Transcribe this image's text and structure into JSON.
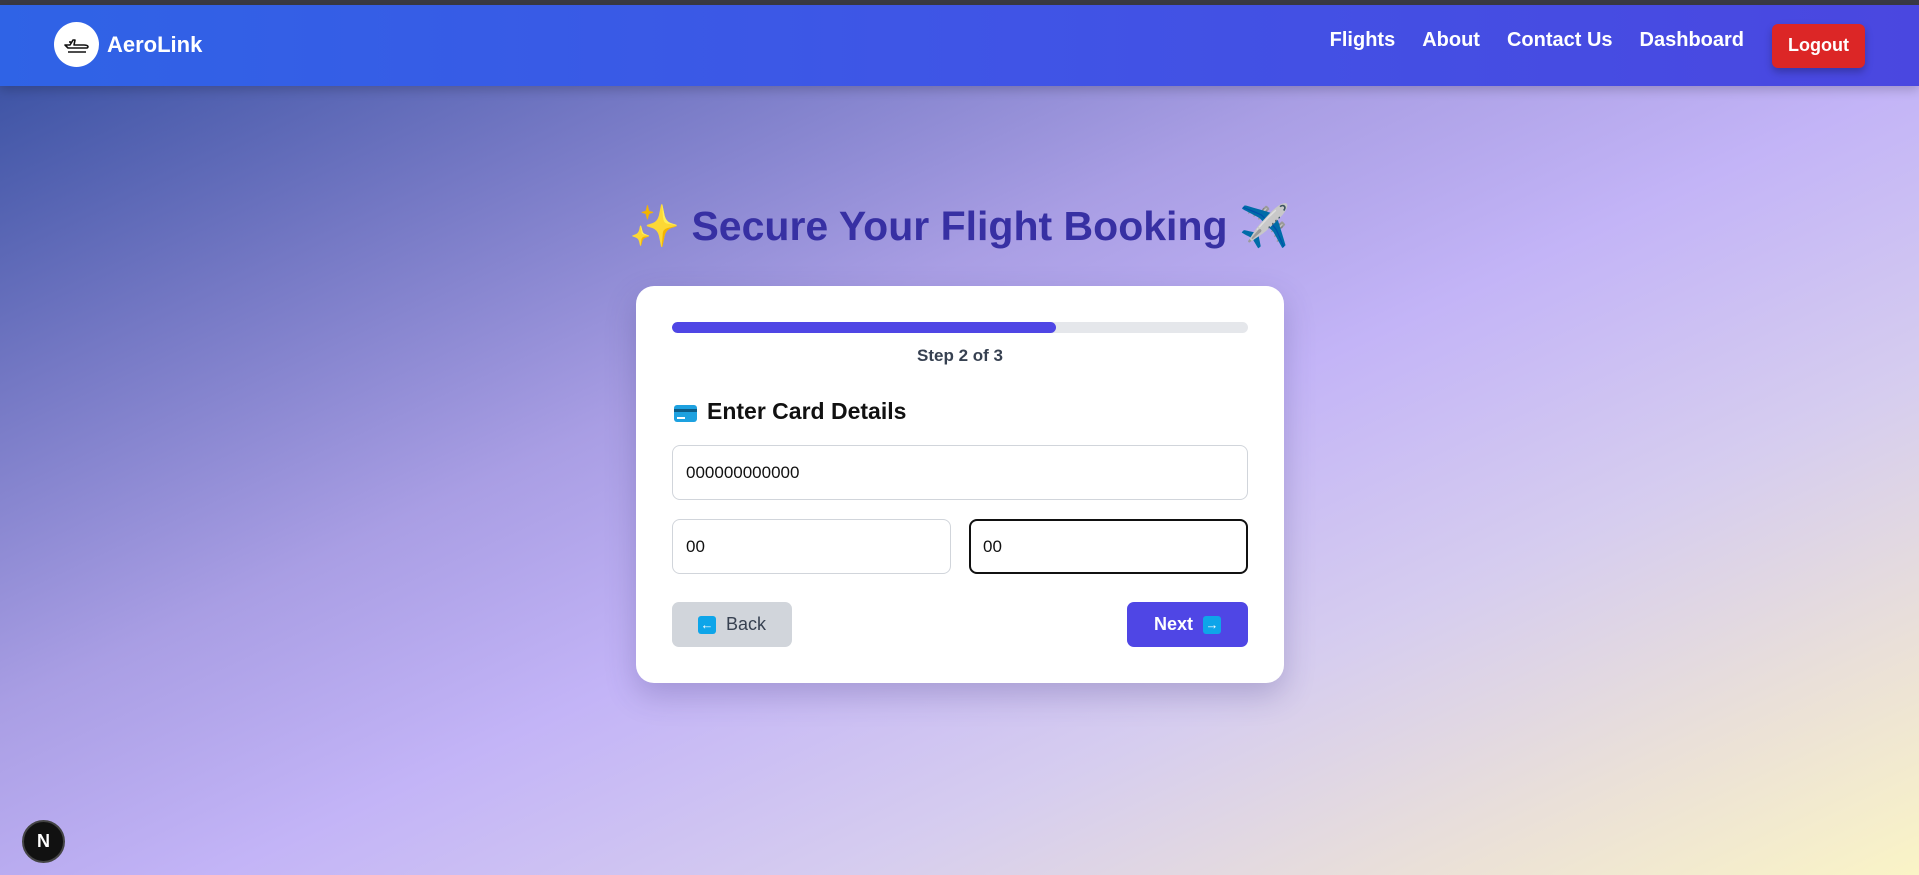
{
  "brand": {
    "name": "AeroLink",
    "logo_icon": "airplane-icon"
  },
  "nav": {
    "links": [
      "Flights",
      "About",
      "Contact Us",
      "Dashboard"
    ],
    "logout_label": "Logout"
  },
  "page": {
    "title": "Secure Your Flight Booking",
    "title_prefix_emoji": "✨",
    "title_suffix_emoji": "✈️"
  },
  "progress": {
    "value": 0.667,
    "step_text": "Step 2 of 3"
  },
  "card_form": {
    "section_icon": "credit-card-icon",
    "section_title": "Enter Card Details",
    "card_number_value": "000000000000",
    "expiry_value": "00",
    "cvv_value": "00"
  },
  "actions": {
    "back_label": "Back",
    "back_icon": "left-arrow-icon",
    "next_label": "Next",
    "next_icon": "right-arrow-icon"
  },
  "dev_badge": {
    "label": "N"
  },
  "colors": {
    "header_gradient_start": "#2f63e6",
    "header_gradient_end": "#4a47e0",
    "accent": "#4f46e5",
    "title": "#3730a3",
    "logout": "#dc2626"
  }
}
